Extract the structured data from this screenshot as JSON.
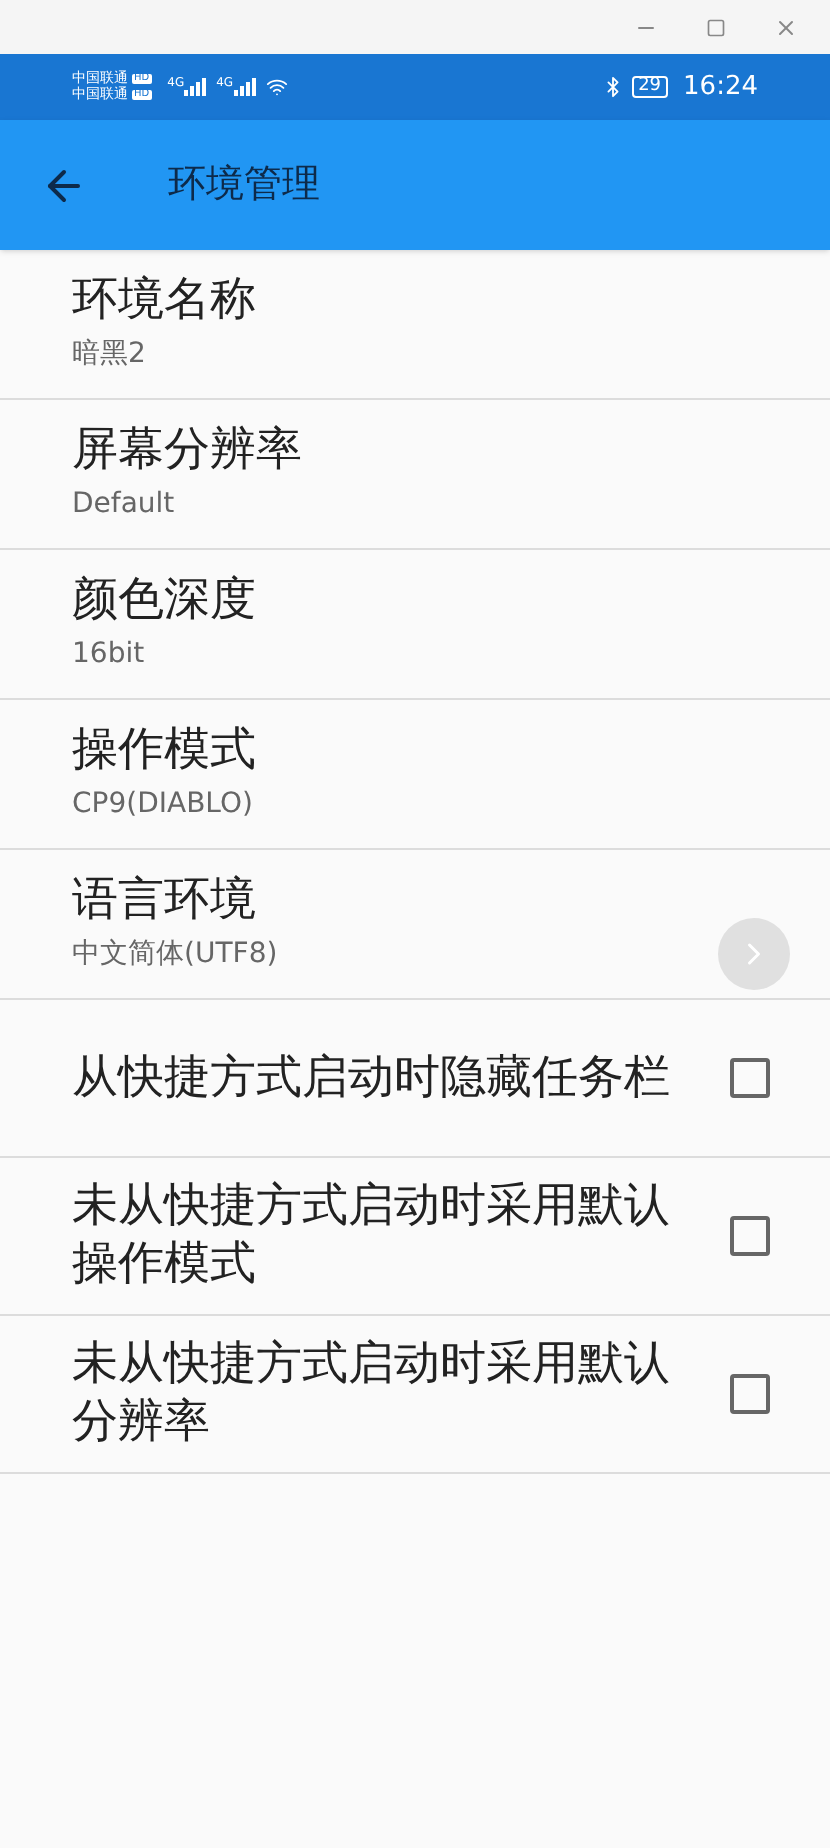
{
  "status_bar": {
    "carriers": [
      {
        "name": "中国联通",
        "badge": "HD"
      },
      {
        "name": "中国联通",
        "badge": "HD"
      }
    ],
    "network_labels": [
      "4G",
      "4G"
    ],
    "battery": "29",
    "time": "16:24"
  },
  "app_bar": {
    "title": "环境管理"
  },
  "settings": [
    {
      "kind": "value",
      "title": "环境名称",
      "value": "暗黑2"
    },
    {
      "kind": "value",
      "title": "屏幕分辨率",
      "value": "Default"
    },
    {
      "kind": "value",
      "title": "颜色深度",
      "value": "16bit"
    },
    {
      "kind": "value",
      "title": "操作模式",
      "value": "CP9(DIABLO)"
    },
    {
      "kind": "value",
      "title": "语言环境",
      "value": "中文简体(UTF8)"
    },
    {
      "kind": "checkbox",
      "title": "从快捷方式启动时隐藏任务栏",
      "checked": false
    },
    {
      "kind": "checkbox",
      "title": "未从快捷方式启动时采用默认操作模式",
      "checked": false
    },
    {
      "kind": "checkbox",
      "title": "未从快捷方式启动时采用默认分辨率",
      "checked": false
    }
  ]
}
